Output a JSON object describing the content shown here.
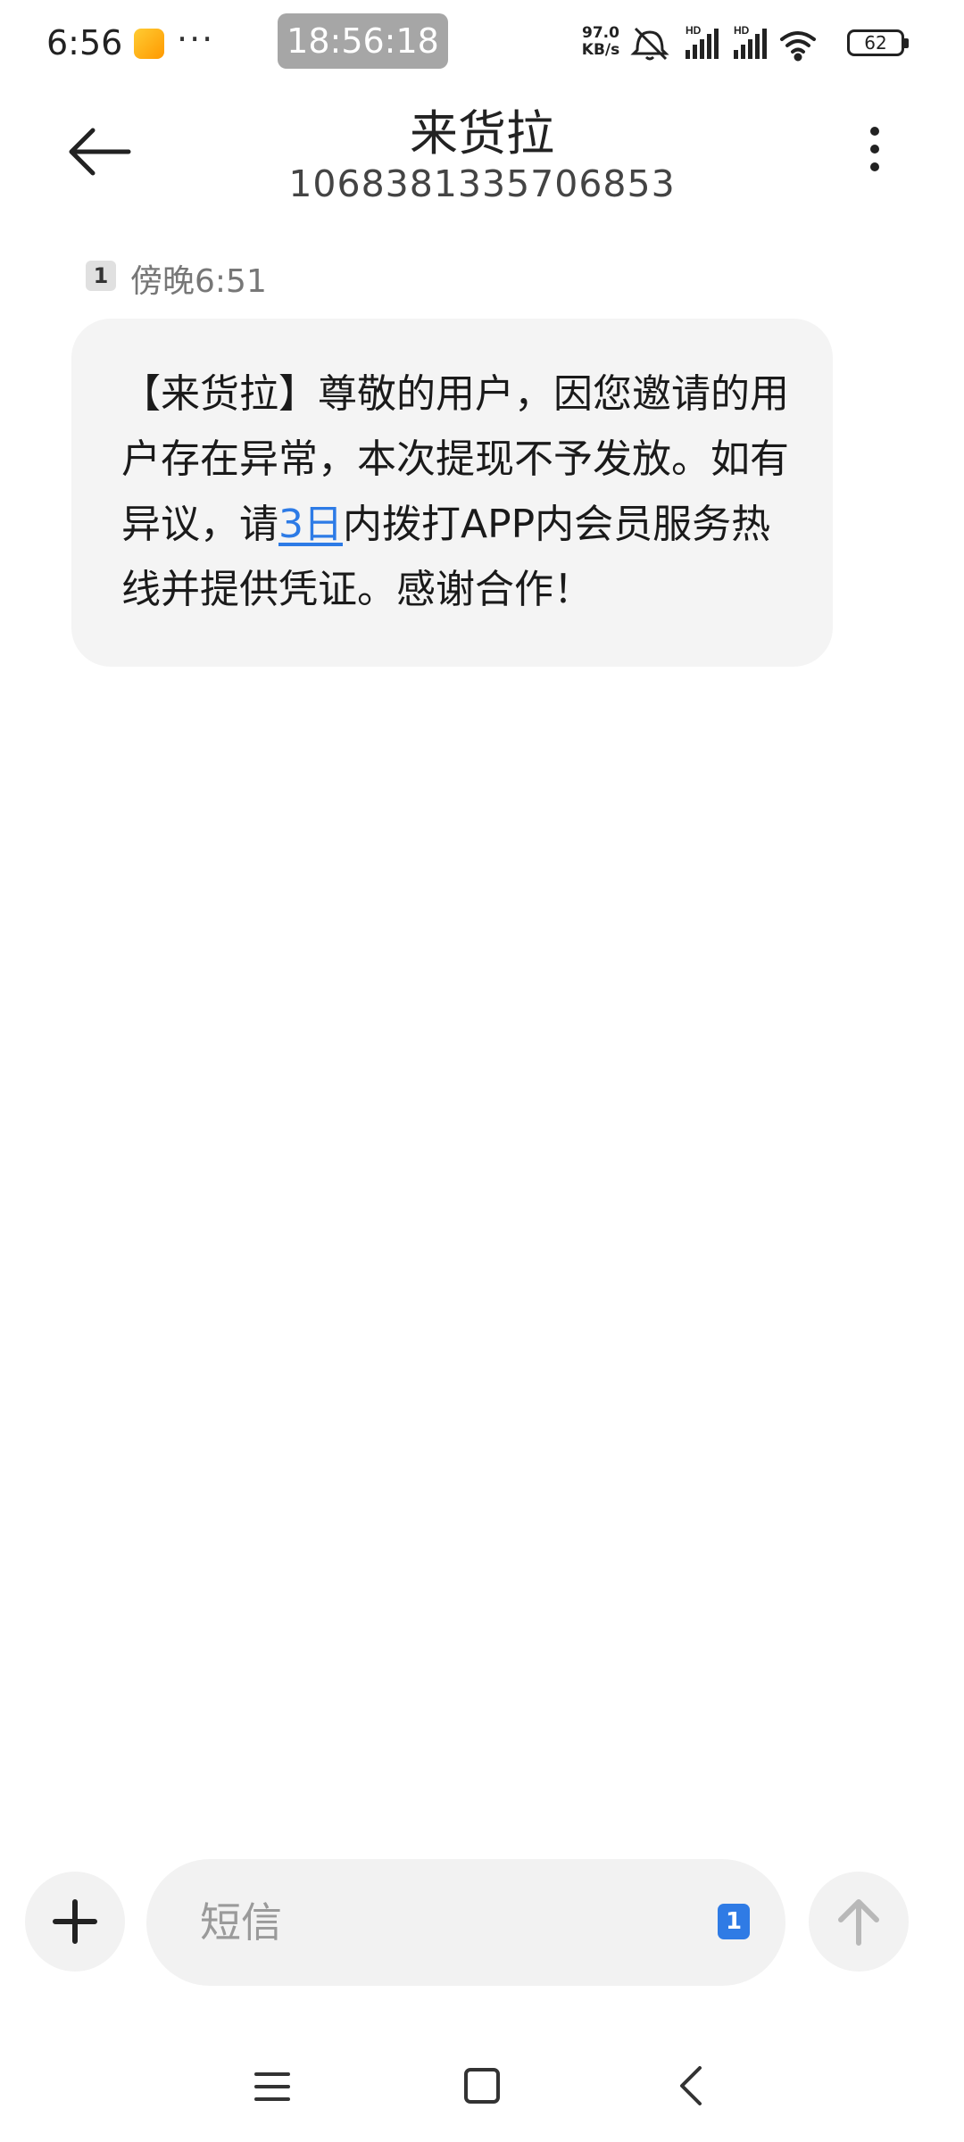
{
  "status_bar": {
    "time": "6:56",
    "more": "···",
    "clock": "18:56:18",
    "speed_value": "97.0",
    "speed_unit": "KB/s",
    "hd1": "HD",
    "hd2": "HD",
    "battery": "62"
  },
  "header": {
    "title": "来货拉",
    "number": "1068381335706853"
  },
  "message": {
    "sim": "1",
    "time": "傍晚6:51",
    "text_before": "【来货拉】尊敬的用户，因您邀请的用户存在异常，本次提现不予发放。如有异议，请",
    "link": "3日",
    "text_after": "内拨打APP内会员服务热线并提供凭证。感谢合作！"
  },
  "composer": {
    "placeholder": "短信",
    "value": "",
    "sim": "1"
  },
  "colors": {
    "accent": "#2f7be5",
    "bubble": "#f4f4f4",
    "link": "#2d7be6"
  }
}
